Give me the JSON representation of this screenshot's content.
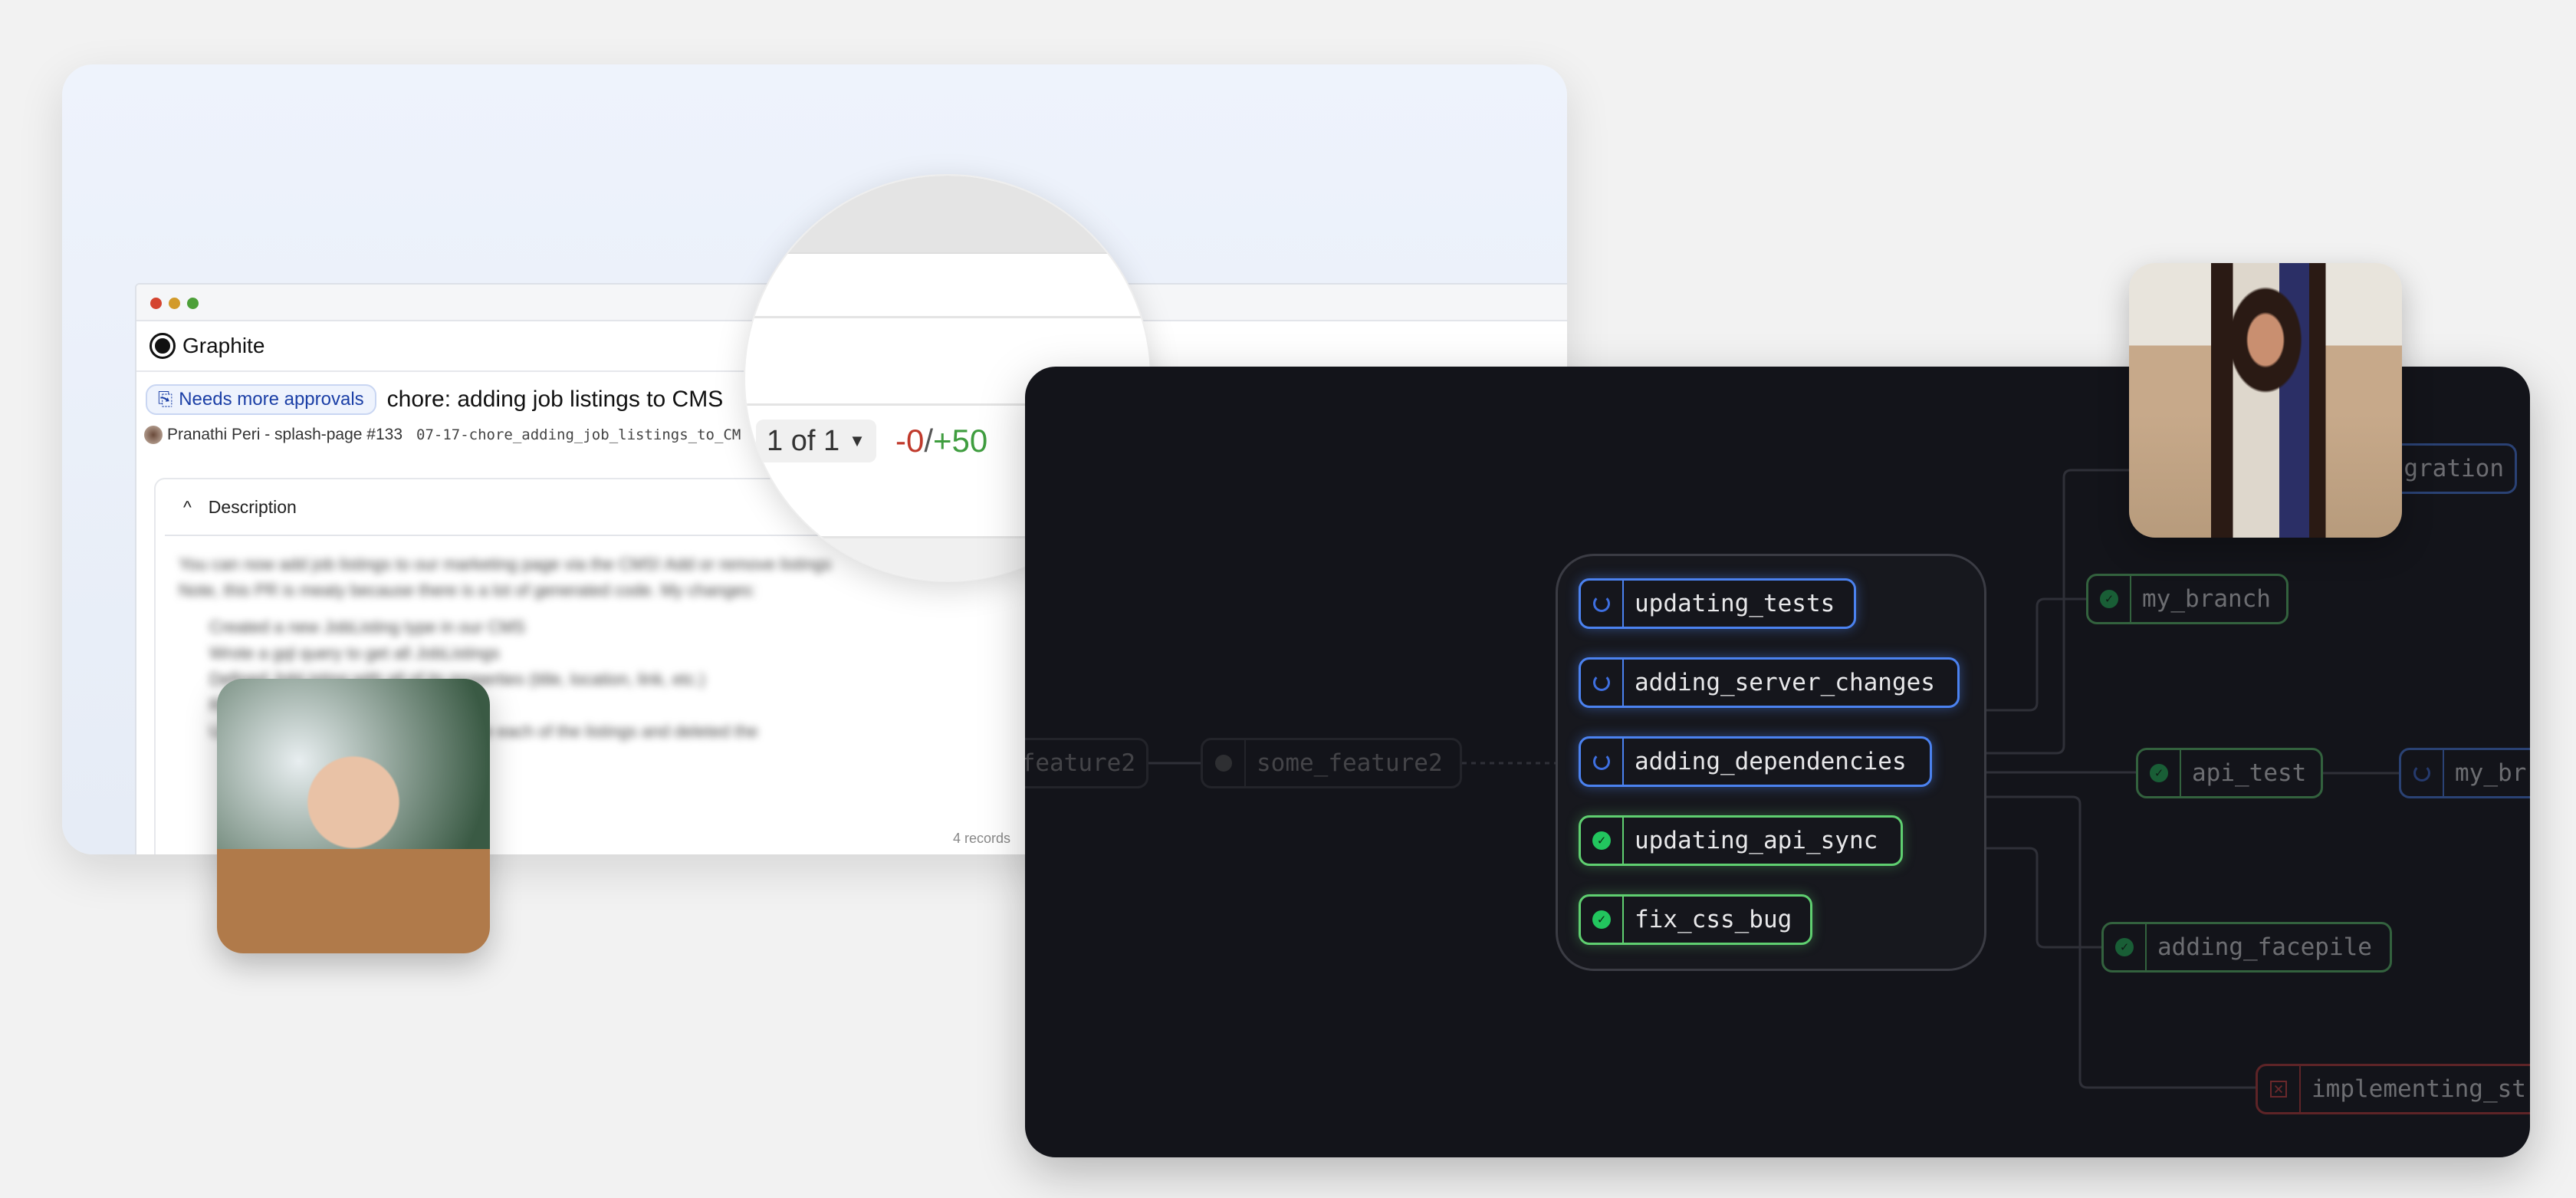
{
  "pr_window": {
    "app_name": "Graphite",
    "status_badge": "Needs more approvals",
    "title": "chore: adding job listings to CMS",
    "author_line": "Pranathi Peri - splash-page #133",
    "branch": "07-17-chore_adding_job_listings_to_CM",
    "description_header": "Description",
    "description_lines": [
      "You can now add job listings to our marketing page via the CMS! Add or remove listings",
      "Note, this PR is meaty because there is a lot of generated code. My changes:"
    ],
    "description_bullets": [
      "Created a new JobListing type in our CMS",
      "Wrote a gql query to get all JobListings",
      "Defined JobListing with all of its properties (title, location, link, etc.)",
      "Regenerated the generated files",
      "Updated the careers page to populate each of the listings and deleted the"
    ],
    "footer_hint": "4 records"
  },
  "magnifier": {
    "version_selector": "1 of 1",
    "deletions": "-0",
    "separator": "/",
    "additions": "+50",
    "deletion_color": "#c0392b",
    "addition_color": "#3f9d3f"
  },
  "stack": {
    "group_nodes": [
      {
        "label": "updating_tests",
        "status": "running"
      },
      {
        "label": "adding_server_changes",
        "status": "running"
      },
      {
        "label": "adding_dependencies",
        "status": "running"
      },
      {
        "label": "updating_api_sync",
        "status": "passed"
      },
      {
        "label": "fix_css_bug",
        "status": "passed"
      }
    ],
    "other_nodes": {
      "feature2": "feature2",
      "some_feature2": "some_feature2",
      "gration": "gration",
      "my_branch": "my_branch",
      "api_test": "api_test",
      "my_br": "my_br",
      "adding_facepile": "adding_facepile",
      "implementing_st": "implementing_st"
    },
    "colors": {
      "running": "#4b82f0",
      "passed": "#5fcf70",
      "failed": "#c53a3a",
      "background": "#13141a"
    }
  }
}
